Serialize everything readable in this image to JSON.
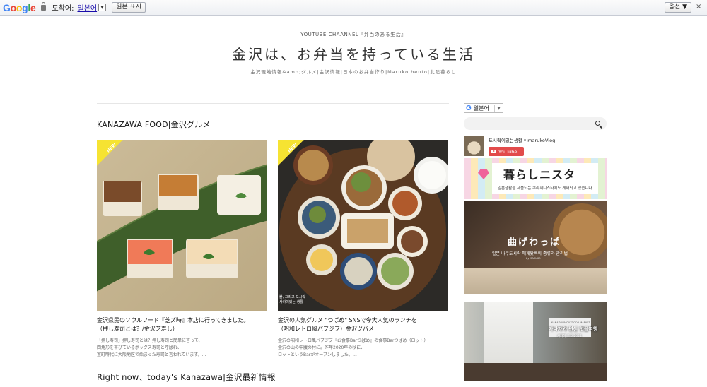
{
  "translate_bar": {
    "logo": [
      "G",
      "o",
      "o",
      "g",
      "l",
      "e"
    ],
    "target_label": "도착어:",
    "target_language": "일본어",
    "dropdown_arrow": "▼",
    "show_original": "원본 표시",
    "options": "옵션 ▼",
    "close": "×"
  },
  "header": {
    "kicker": "YOUTUBE CHAANNEL『弁当のある生活』",
    "title": "金沢は、お弁当を持っている生活",
    "tagline": "金沢現地情報&amp;グルメ|金沢情報|日本のお弁当作り|Maruko bento|北陸暮らし"
  },
  "main": {
    "section1_title": "KANAZAWA FOOD|金沢グルメ",
    "posts": [
      {
        "badge": "NEW",
        "title_line1": "金沢県民のソウルフード『芝ズ時』本店に行ってきました。",
        "title_line2": "（押し寿司とは？/金沢芝寿し）",
        "excerpt_line1": "「押し寿司」押し寿司とは？押し寿司と簡単に言って、",
        "excerpt_line2": "四角形を帯びているボックス寿司と呼ばれ、",
        "excerpt_line3": "室町時代に大阪地区で始まった寿司と言われています。…"
      },
      {
        "badge": "NEW",
        "title_line1": "金沢の人気グルメ \"つばめ\" SNSで今大人気のランチを",
        "title_line2": "（昭和レトロ風バブジブ）金沢ツバメ",
        "excerpt_line1": "金沢の昭和レトロ風バブジブ『お食事Barつばめ』の食事Barつばめ（ロット）",
        "excerpt_line2": "金沢の山の中腹の村に。昨年2020年の秋に、",
        "excerpt_line3": "ロットというBarがオープンしました。…",
        "thumb_caption_line1": "볼, 그리고 도시락",
        "thumb_caption_line2": "사카이있는 생활"
      }
    ],
    "section2_title": "Right now、today's Kanazawa|金沢最新情報"
  },
  "sidebar": {
    "lang_g": "G",
    "lang_label": "일본어",
    "lang_arrow": "▼",
    "youtube": {
      "channel_name": "도시락이있는생활 * marukoVlog",
      "button_label": "YouTube"
    },
    "banner1": {
      "title": "暮らしニスタ",
      "subtitle": "일본생활블 제품되는 쿠라시니스타에도 게재되고 있습니다."
    },
    "banner2": {
      "title": "曲げわっぱ",
      "subtitle": "일본 나무도시락 매게왓빠의 종류와 관리법",
      "signature": "by MARUKO"
    },
    "banner3": {
      "small": "KANAZAWA OUTDOOR MARKET",
      "title": "가나자와 편센 핫플여행",
      "subtitle": "사카하 도쿄 2021"
    }
  }
}
